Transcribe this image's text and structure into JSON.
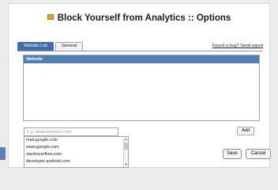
{
  "header": {
    "title": "Block Yourself from Analytics :: Options",
    "icon": "extension-icon"
  },
  "tabs": [
    {
      "label": "Website List",
      "active": true
    },
    {
      "label": "General",
      "active": false
    }
  ],
  "bug_link": "Found a bug? Send report",
  "table": {
    "column_header": "Website",
    "rows": []
  },
  "input": {
    "placeholder": "e.g. www.example.com",
    "value": ""
  },
  "add_label": "Add",
  "suggestions": [
    "mail.google.com",
    "www.google.com",
    "stackoverflow.com",
    "developer.android.com"
  ],
  "buttons": {
    "save": "Save",
    "cancel": "Cancel"
  },
  "colors": {
    "accent": "#3f6ea8",
    "table_header": "#4f7fb5"
  }
}
